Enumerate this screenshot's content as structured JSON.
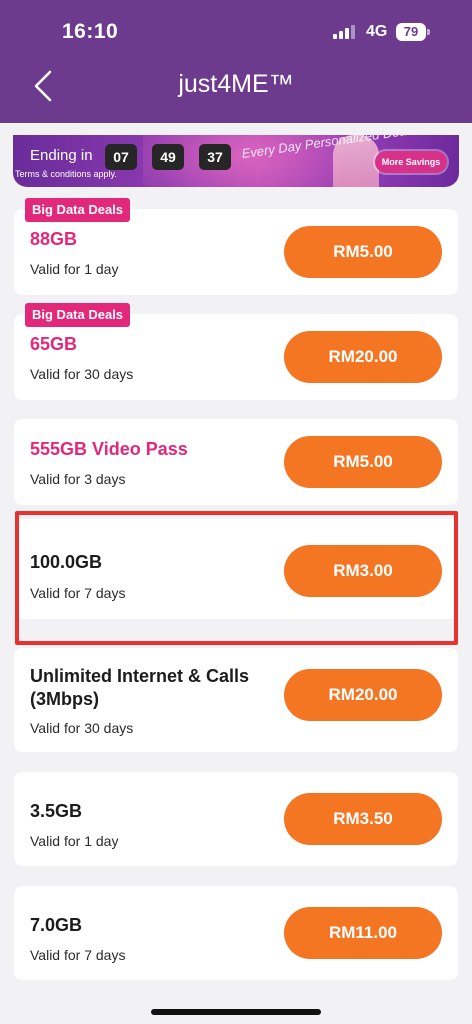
{
  "status_bar": {
    "time": "16:10",
    "network": "4G",
    "battery": "79"
  },
  "header": {
    "title": "just4ME™",
    "back_icon": "chevron-left-icon"
  },
  "banner": {
    "ending_label": "Ending in",
    "countdown": [
      "07",
      "49",
      "37"
    ],
    "terms": "Terms & conditions apply.",
    "deco_text": "Every Day Personalized Deals",
    "more_savings": "More Savings"
  },
  "offers": [
    {
      "badge": "Big Data Deals",
      "name": "88GB",
      "validity": "Valid for 1 day",
      "price": "RM5.00"
    },
    {
      "badge": "Big Data Deals",
      "name": "65GB",
      "validity": "Valid for 30 days",
      "price": "RM20.00"
    },
    {
      "name": "555GB Video Pass",
      "validity": "Valid for 3 days",
      "price": "RM5.00"
    },
    {
      "name": "100.0GB",
      "validity": "Valid for 7 days",
      "price": "RM3.00"
    },
    {
      "name_line1": "Unlimited Internet & Calls",
      "name_line2": "(3Mbps)",
      "validity": "Valid for 30 days",
      "price": "RM20.00"
    },
    {
      "name": "3.5GB",
      "validity": "Valid for 1 day",
      "price": "RM3.50"
    },
    {
      "name": "7.0GB",
      "validity": "Valid for 7 days",
      "price": "RM11.00"
    }
  ],
  "colors": {
    "header": "#6c3b8e",
    "price_button": "#f47623",
    "badge": "#e2287a",
    "highlight": "#e8322f"
  }
}
